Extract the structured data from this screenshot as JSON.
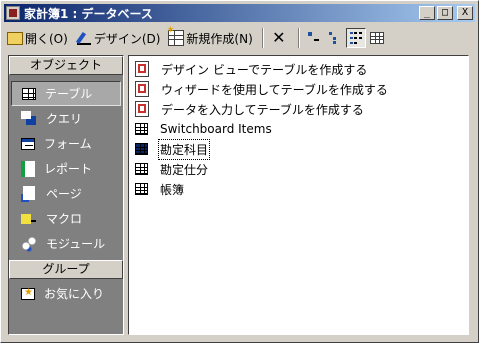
{
  "window": {
    "title": "家計簿1 : データベース",
    "controls": {
      "minimize": "_",
      "maximize": "□",
      "close": "X"
    }
  },
  "toolbar": {
    "open_label": "開く(O)",
    "design_label": "デザイン(D)",
    "new_label": "新規作成(N)",
    "delete_glyph": "✕"
  },
  "sidebar": {
    "objects_header": "オブジェクト",
    "items": [
      {
        "label": "テーブル",
        "icon": "table-icon",
        "active": true
      },
      {
        "label": "クエリ",
        "icon": "query-icon"
      },
      {
        "label": "フォーム",
        "icon": "form-icon"
      },
      {
        "label": "レポート",
        "icon": "report-icon"
      },
      {
        "label": "ページ",
        "icon": "page-icon"
      },
      {
        "label": "マクロ",
        "icon": "macro-icon"
      },
      {
        "label": "モジュール",
        "icon": "module-icon"
      }
    ],
    "groups_header": "グループ",
    "groups": [
      {
        "label": "お気に入り",
        "icon": "favorites-icon"
      }
    ]
  },
  "list": {
    "items": [
      {
        "label": "デザイン ビューでテーブルを作成する",
        "icon": "shortcut-icon"
      },
      {
        "label": "ウィザードを使用してテーブルを作成する",
        "icon": "shortcut-icon"
      },
      {
        "label": "データを入力してテーブルを作成する",
        "icon": "shortcut-icon"
      },
      {
        "label": "Switchboard Items",
        "icon": "table-icon"
      },
      {
        "label": "勘定科目",
        "icon": "table-icon",
        "selected": true
      },
      {
        "label": "勘定仕分",
        "icon": "table-icon"
      },
      {
        "label": "帳簿",
        "icon": "table-icon"
      }
    ]
  }
}
